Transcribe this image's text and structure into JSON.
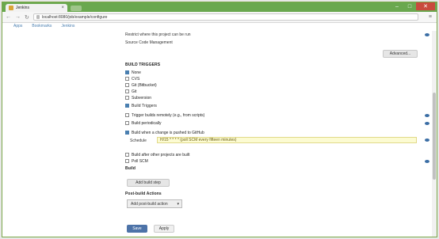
{
  "browser": {
    "tab_title": "Jenkins",
    "address": "localhost:8080/job/example/configure",
    "back_icon": "back-arrow-icon",
    "forward_icon": "forward-arrow-icon",
    "reload_icon": "reload-icon",
    "menu_icon": "hamburger-menu-icon"
  },
  "bookmarks": [
    "Apps",
    "Bookmarks",
    "Jenkins"
  ],
  "form": {
    "top_note": "Restrict where this project can be run",
    "subtitle": "Source Code Management",
    "advanced_button": "Advanced...",
    "section_title": "BUILD TRIGGERS",
    "options": [
      {
        "label": "None",
        "checked": true
      },
      {
        "label": "CVS",
        "checked": false
      },
      {
        "label": "Git (Bitbucket)",
        "checked": false
      },
      {
        "label": "Git",
        "checked": false
      },
      {
        "label": "Subversion",
        "checked": false
      }
    ],
    "trigger_section": "Build Triggers",
    "triggers": [
      {
        "label": "Trigger builds remotely (e.g., from scripts)",
        "checked": false
      },
      {
        "label": "Build periodically",
        "checked": false
      },
      {
        "label": "Build when a change is pushed to GitHub",
        "checked": true
      }
    ],
    "schedule_label": "Schedule",
    "schedule_value": "H/15 * * * * (poll SCM every fifteen minutes)",
    "more_triggers": [
      {
        "label": "Build after other projects are built",
        "checked": false
      },
      {
        "label": "Poll SCM",
        "checked": false
      }
    ],
    "build_label": "Build",
    "add_step_button": "Add build step",
    "post_build_title": "Post-build Actions",
    "post_build_select": "Add post-build action",
    "save_button": "Save",
    "apply_button": "Apply"
  }
}
